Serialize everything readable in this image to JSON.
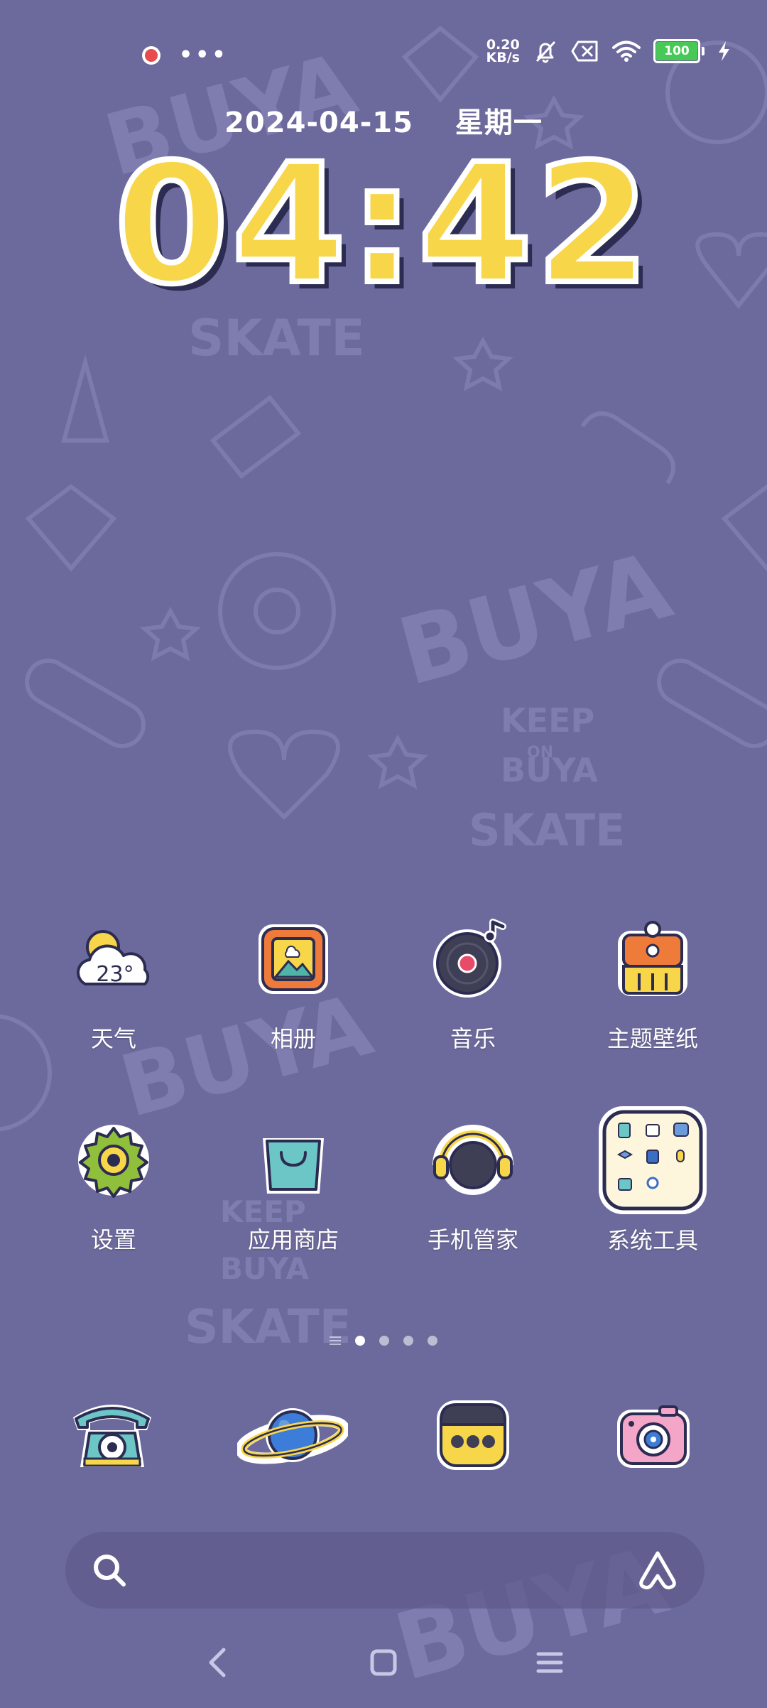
{
  "status_bar": {
    "net_speed_value": "0.20",
    "net_speed_unit": "KB/s",
    "battery_level": "100",
    "icons": [
      "record-dot-icon",
      "more-dots-icon",
      "mute-bell-icon",
      "no-sim-icon",
      "wifi-icon",
      "battery-icon",
      "charging-bolt-icon"
    ]
  },
  "clock_widget": {
    "date": "2024-04-15",
    "weekday": "星期一",
    "time": "04:42"
  },
  "apps": [
    {
      "label": "天气",
      "icon": "weather-icon",
      "temp": "23°"
    },
    {
      "label": "相册",
      "icon": "gallery-icon"
    },
    {
      "label": "音乐",
      "icon": "music-icon"
    },
    {
      "label": "主题壁纸",
      "icon": "themes-icon"
    },
    {
      "label": "设置",
      "icon": "settings-gear-icon"
    },
    {
      "label": "应用商店",
      "icon": "app-store-bag-icon"
    },
    {
      "label": "手机管家",
      "icon": "security-headphones-icon"
    },
    {
      "label": "系统工具",
      "icon": "system-tools-folder-icon"
    }
  ],
  "pages": {
    "count": 4,
    "active": 0
  },
  "dock": [
    "phone-icon",
    "browser-planet-icon",
    "messages-icon",
    "camera-icon"
  ],
  "wallpaper_text": [
    "BUYA",
    "SKATE",
    "KEEP",
    "ON",
    "BUYA"
  ],
  "colors": {
    "background": "#6c6a9c",
    "clock_fill": "#f8d64a",
    "clock_shadow": "#2c2c52",
    "battery_green": "#48c957"
  }
}
